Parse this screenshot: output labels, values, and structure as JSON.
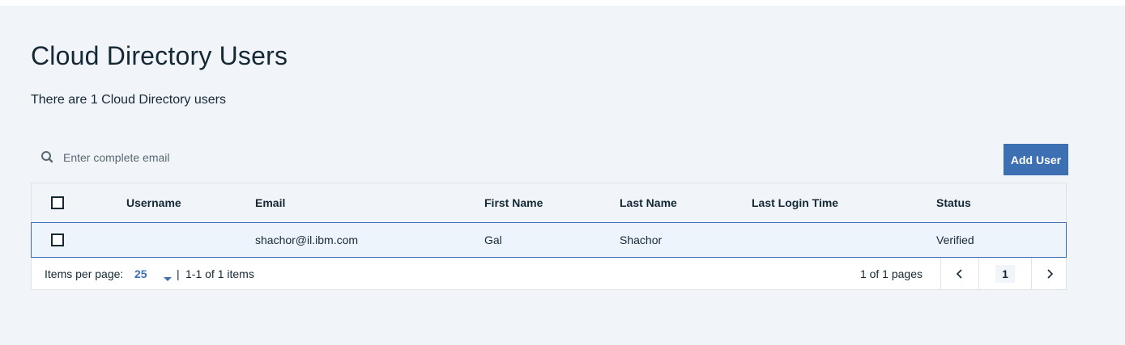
{
  "page": {
    "title": "Cloud Directory Users",
    "summary": "There are 1 Cloud Directory users"
  },
  "search": {
    "placeholder": "Enter complete email",
    "icon": "search-icon"
  },
  "toolbar": {
    "add_user_label": "Add User"
  },
  "table": {
    "columns": [
      "Username",
      "Email",
      "First Name",
      "Last Name",
      "Last Login Time",
      "Status"
    ],
    "rows": [
      {
        "selected": false,
        "username": "",
        "email": "shachor@il.ibm.com",
        "first_name": "Gal",
        "last_name": "Shachor",
        "last_login": "",
        "status": "Verified"
      }
    ]
  },
  "pagination": {
    "items_per_page_label": "Items per page:",
    "items_per_page_value": "25",
    "separator": "|",
    "range_text": "1-1 of 1 items",
    "pages_text": "1 of 1 pages",
    "current_page": "1"
  },
  "colors": {
    "accent": "#3d70b2",
    "background": "#f1f4f9",
    "text": "#152935",
    "row_selected_bg": "#eef4fc"
  }
}
